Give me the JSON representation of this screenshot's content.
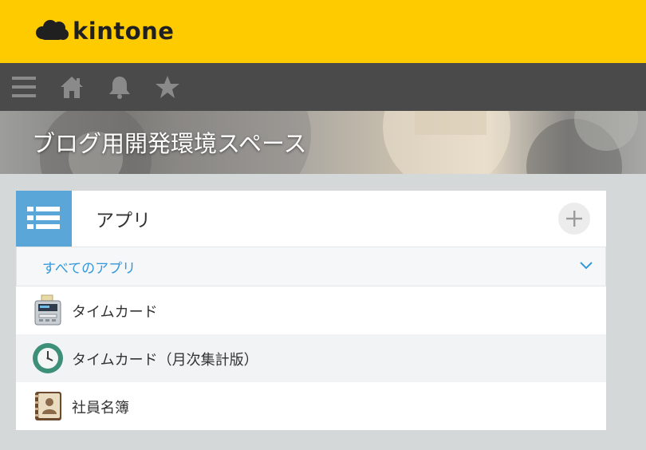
{
  "brand": {
    "logo_text": "kintone"
  },
  "nav": {
    "icons": [
      "menu-icon",
      "home-icon",
      "bell-icon",
      "star-icon"
    ]
  },
  "space": {
    "title": "ブログ用開発環境スペース"
  },
  "apps_panel": {
    "title": "アプリ",
    "filter_label": "すべてのアプリ",
    "items": [
      {
        "name": "タイムカード",
        "icon": "timecard-machine-icon"
      },
      {
        "name": "タイムカード（月次集計版）",
        "icon": "clock-icon"
      },
      {
        "name": "社員名簿",
        "icon": "address-book-icon"
      }
    ]
  },
  "colors": {
    "brand_yellow": "#fecb00",
    "nav_gray": "#4a4a4a",
    "accent_blue": "#3498db",
    "panel_icon_blue": "#5aa6d8",
    "page_bg": "#d5d8d9"
  }
}
